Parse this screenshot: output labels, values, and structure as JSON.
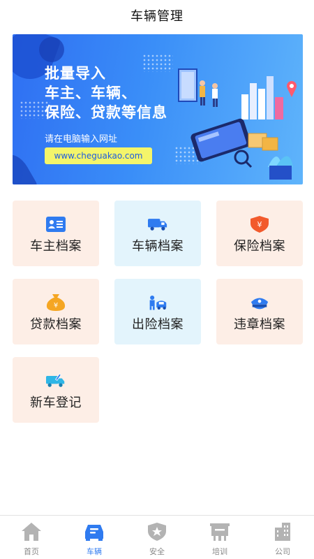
{
  "header": {
    "title": "车辆管理"
  },
  "banner": {
    "headline_lines": [
      "批量导入",
      "车主、车辆、",
      "保险、贷款等信息"
    ],
    "hint": "请在电脑输入网址",
    "url": "www.cheguakao.com"
  },
  "tiles": [
    {
      "label": "车主档案",
      "icon": "id-card-icon",
      "color": "#2f7bf0"
    },
    {
      "label": "车辆档案",
      "icon": "truck-icon",
      "color": "#2f7bf0"
    },
    {
      "label": "保险档案",
      "icon": "shield-yuan-icon",
      "color": "#f25a2c"
    },
    {
      "label": "贷款档案",
      "icon": "money-bag-icon",
      "color": "#f5a623"
    },
    {
      "label": "出险档案",
      "icon": "accident-icon",
      "color": "#2f7bf0"
    },
    {
      "label": "违章档案",
      "icon": "police-cap-icon",
      "color": "#2f7bf0"
    },
    {
      "label": "新车登记",
      "icon": "new-truck-icon",
      "color": "#2fb6e6"
    }
  ],
  "tabbar": {
    "items": [
      {
        "label": "首页",
        "icon": "home-icon",
        "active": false
      },
      {
        "label": "车辆",
        "icon": "car-icon",
        "active": true
      },
      {
        "label": "安全",
        "icon": "shield-star-icon",
        "active": false
      },
      {
        "label": "培训",
        "icon": "training-board-icon",
        "active": false
      },
      {
        "label": "公司",
        "icon": "building-icon",
        "active": false
      }
    ]
  },
  "colors": {
    "accent": "#2f7bf0",
    "inactive": "#888888",
    "tile_peach": "#fdeee6",
    "tile_blue": "#e3f4fc"
  }
}
